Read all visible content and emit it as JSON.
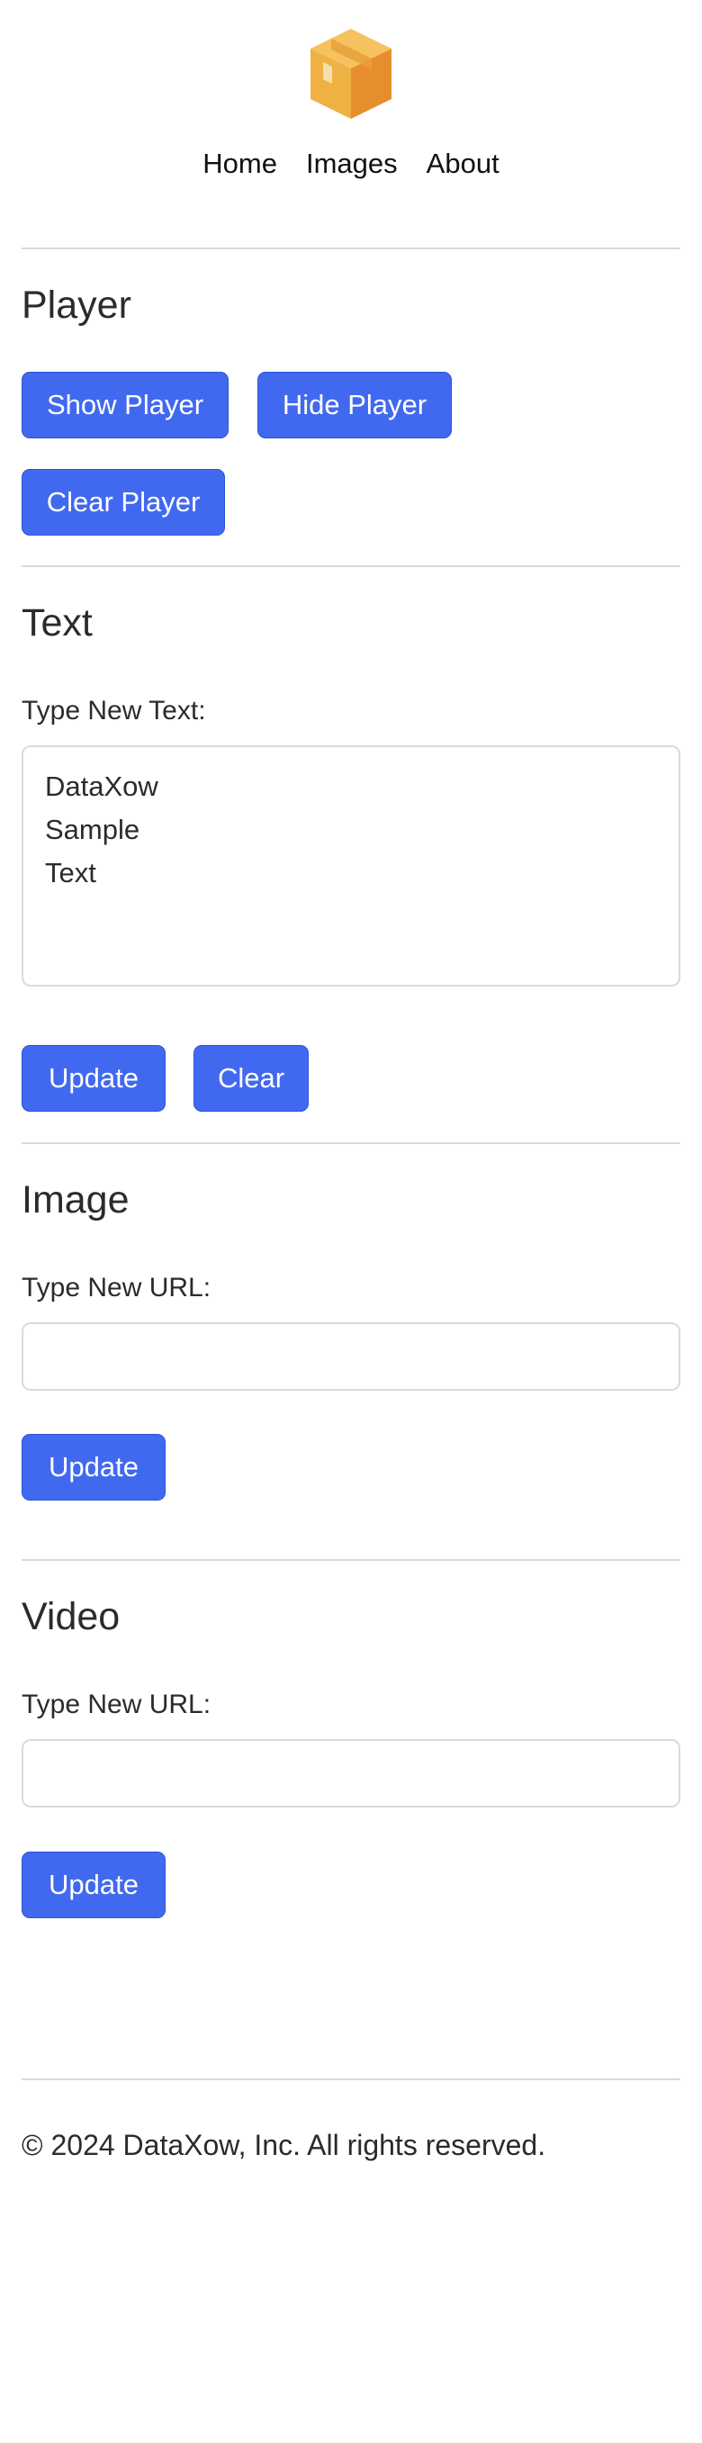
{
  "header": {
    "logo_icon": "package-box-icon",
    "nav": [
      {
        "label": "Home"
      },
      {
        "label": "Images"
      },
      {
        "label": "About"
      }
    ]
  },
  "player_section": {
    "title": "Player",
    "show_label": "Show Player",
    "hide_label": "Hide Player",
    "clear_label": "Clear Player"
  },
  "text_section": {
    "title": "Text",
    "field_label": "Type New Text:",
    "field_value": "DataXow\nSample\nText",
    "update_label": "Update",
    "clear_label": "Clear"
  },
  "image_section": {
    "title": "Image",
    "field_label": "Type New URL:",
    "field_value": "",
    "update_label": "Update"
  },
  "video_section": {
    "title": "Video",
    "field_label": "Type New URL:",
    "field_value": "",
    "update_label": "Update"
  },
  "footer": {
    "copyright": "© 2024 DataXow, Inc. All rights reserved."
  },
  "colors": {
    "button_primary": "#4169f0",
    "logo_orange_light": "#f2b448",
    "logo_orange_dark": "#e8912e"
  }
}
